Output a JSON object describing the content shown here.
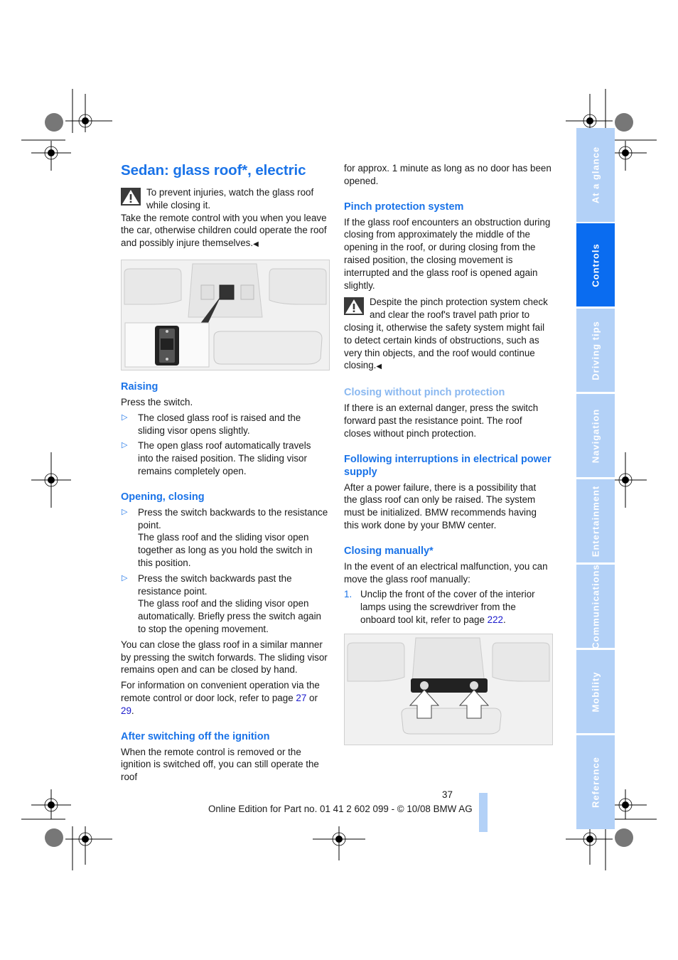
{
  "page": {
    "title": "Sedan: glass roof*, electric",
    "page_number": "37",
    "footer": "Online Edition for Part no. 01 41 2 602 099 - © 10/08 BMW AG",
    "accent_color": "#1a73e8",
    "end_mark": "◀"
  },
  "sidebar": {
    "tabs": [
      {
        "label": "At a glance",
        "active": false
      },
      {
        "label": "Controls",
        "active": true
      },
      {
        "label": "Driving tips",
        "active": false
      },
      {
        "label": "Navigation",
        "active": false
      },
      {
        "label": "Entertainment",
        "active": false
      },
      {
        "label": "Communications",
        "active": false
      },
      {
        "label": "Mobility",
        "active": false
      },
      {
        "label": "Reference",
        "active": false
      }
    ]
  },
  "left": {
    "warning": "To prevent injuries, watch the glass roof while closing it.",
    "warning_cont": "Take the remote control with you when you leave the car, otherwise children could operate the roof and possibly injure themselves.",
    "figure1": {
      "icon": "roof-switch-illustration"
    },
    "raising": {
      "heading": "Raising",
      "intro": "Press the switch.",
      "bullets": [
        "The closed glass roof is raised and the sliding visor opens slightly.",
        "The open glass roof automatically travels into the raised position. The sliding visor remains completely open."
      ]
    },
    "opening": {
      "heading": "Opening, closing",
      "bullets": [
        {
          "line1": "Press the switch backwards to the resistance point.",
          "line2": "The glass roof and the sliding visor open together as long as you hold the switch in this position."
        },
        {
          "line1": "Press the switch backwards past the resistance point.",
          "line2": "The glass roof and the sliding visor open automatically. Briefly press the switch again to stop the opening movement."
        }
      ],
      "para1": "You can close the glass roof in a similar manner by pressing the switch forwards. The sliding visor remains open and can be closed by hand.",
      "para2_pre": "For information on convenient operation via the remote control or door lock, refer to page ",
      "link1": "27",
      "para2_mid": " or ",
      "link2": "29",
      "para2_post": "."
    },
    "after": {
      "heading": "After switching off the ignition",
      "text": "When the remote control is removed or the ignition is switched off, you can still operate the roof"
    }
  },
  "right": {
    "cont": "for approx. 1 minute as long as no door has been opened.",
    "pinch": {
      "heading": "Pinch protection system",
      "text": "If the glass roof encounters an obstruction during closing from approximately the middle of the opening in the roof, or during closing from the raised position, the closing movement is interrupted and the glass roof is opened again slightly.",
      "warning": "Despite the pinch protection system check and clear the roof's travel path prior to closing it, otherwise the safety system might fail to detect certain kinds of obstructions, such as very thin objects, and the roof would continue closing."
    },
    "without": {
      "heading": "Closing without pinch protection",
      "text": "If there is an external danger, press the switch forward past the resistance point. The roof closes without pinch protection."
    },
    "interrupt": {
      "heading": "Following interruptions in electrical power supply",
      "text": "After a power failure, there is a possibility that the glass roof can only be raised. The system must be initialized. BMW recommends having this work done by your BMW center."
    },
    "manual": {
      "heading": "Closing manually*",
      "text": "In the event of an electrical malfunction, you can move the glass roof manually:",
      "step_num": "1.",
      "step_text": "Unclip the front of the cover of the interior lamps using the screwdriver from the onboard tool kit, refer to page ",
      "step_link": "222",
      "step_end": "."
    },
    "figure2": {
      "icon": "interior-lamp-cover-illustration"
    }
  }
}
